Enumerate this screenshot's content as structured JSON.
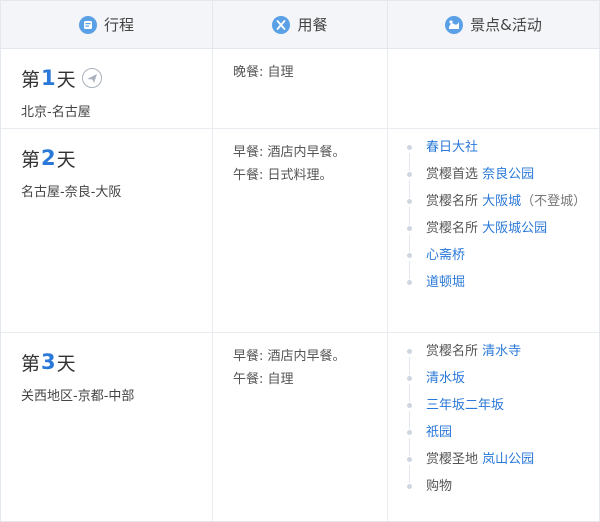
{
  "header": {
    "itinerary_label": "行程",
    "meals_label": "用餐",
    "activities_label": "景点&活动"
  },
  "days": [
    {
      "prefix": "第",
      "num": "1",
      "suffix": "天",
      "route": "北京-名古屋",
      "meals": [
        "晚餐: 自理"
      ],
      "activities": []
    },
    {
      "prefix": "第",
      "num": "2",
      "suffix": "天",
      "route": "名古屋-奈良-大阪",
      "meals": [
        "早餐: 酒店内早餐。",
        "午餐: 日式料理。"
      ],
      "activities": [
        {
          "pre": "",
          "link": "春日大社",
          "post": ""
        },
        {
          "pre": "赏樱首选 ",
          "link": "奈良公园",
          "post": ""
        },
        {
          "pre": "赏樱名所 ",
          "link": "大阪城",
          "post": "（不登城）"
        },
        {
          "pre": "赏樱名所 ",
          "link": "大阪城公园",
          "post": ""
        },
        {
          "pre": "",
          "link": "心斋桥",
          "post": ""
        },
        {
          "pre": "",
          "link": "道顿堀",
          "post": ""
        }
      ]
    },
    {
      "prefix": "第",
      "num": "3",
      "suffix": "天",
      "route": "关西地区-京都-中部",
      "meals": [
        "早餐: 酒店内早餐。",
        "午餐: 自理"
      ],
      "activities": [
        {
          "pre": "赏樱名所 ",
          "link": "清水寺",
          "post": ""
        },
        {
          "pre": "",
          "link": "清水坂",
          "post": ""
        },
        {
          "pre": "",
          "link": "三年坂二年坂",
          "post": ""
        },
        {
          "pre": "",
          "link": "祇园",
          "post": ""
        },
        {
          "pre": "赏樱圣地 ",
          "link": "岚山公园",
          "post": ""
        },
        {
          "pre": "购物",
          "link": "",
          "post": ""
        }
      ]
    }
  ],
  "icons": {
    "itinerary": "itinerary-icon",
    "meals": "meals-icon",
    "activities": "activities-icon",
    "flight": "plane-icon"
  },
  "colors": {
    "accent": "#2a78d8",
    "header_bg": "#f3f5f8",
    "border": "#e3e7ee"
  }
}
